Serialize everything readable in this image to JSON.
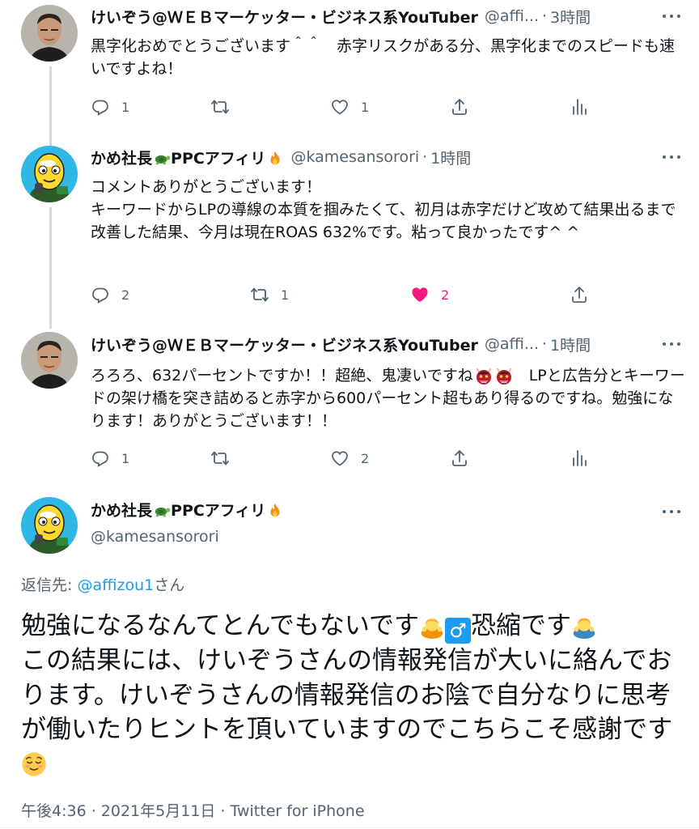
{
  "tweets": [
    {
      "name": "けいぞう@ＷＥＢマーケッター・ビジネス系YouTuber",
      "handle": "@affi...",
      "time": "3時間",
      "text": "黒字化おめでとうございます＾＾　赤字リスクがある分、黒字化までのスピードも速いですよね！",
      "replies": "1",
      "retweets": "",
      "likes": "1",
      "liked": false
    },
    {
      "name_prefix": "かめ社長",
      "name_suffix": "PPCアフィリ",
      "handle": "@kamesansorori",
      "time": "1時間",
      "text": "コメントありがとうございます！\nキーワードからLPの導線の本質を掴みたくて、初月は赤字だけど攻めて結果出るまで改善した結果、今月は現在ROAS 632%です。粘って良かったです^ ^",
      "replies": "2",
      "retweets": "1",
      "likes": "2",
      "liked": true
    },
    {
      "name": "けいぞう@ＷＥＢマーケッター・ビジネス系YouTuber",
      "handle": "@affi...",
      "time": "1時間",
      "text_before_emoji": "ろろろ、632パーセントですか！！超絶、鬼凄いですね",
      "text_after_emoji": "　LPと広告分とキーワードの架け橋を突き詰めると赤字から600パーセント超もあり得るのですね。勉強になります！ありがとうございます！！",
      "replies": "1",
      "retweets": "",
      "likes": "2",
      "liked": false
    }
  ],
  "main_tweet": {
    "name_prefix": "かめ社長",
    "name_suffix": "PPCアフィリ",
    "handle": "@kamesansorori",
    "reply_label": "返信先: ",
    "reply_target": "@affizou1",
    "reply_suffix": "さん",
    "text_1": "勉強になるなんてとんでもないです",
    "male_sign": "♂",
    "text_2": "恐縮です",
    "text_3": "この結果には、けいぞうさんの情報発信が大いに絡んでおります。けいぞうさんの情報発信のお陰で自分なりに思考が働いたりヒントを頂いていますのでこちらこそ感謝です",
    "meta": "午後4:36 · 2021年5月11日 · Twitter for iPhone"
  },
  "icons": {
    "reply": "reply-icon",
    "retweet": "retweet-icon",
    "like": "heart-icon",
    "share": "share-icon",
    "analytics": "analytics-icon",
    "more": "more-icon",
    "turtle": "turtle-emoji",
    "fire": "fire-emoji",
    "oni": "ogre-emoji",
    "bow": "bowing-person-emoji",
    "relieved": "relieved-face-emoji"
  },
  "colors": {
    "text": "#0f1419",
    "secondary": "#536471",
    "accent": "#1d9bf0",
    "like": "#f91880",
    "thread_line": "#cfd9de"
  }
}
